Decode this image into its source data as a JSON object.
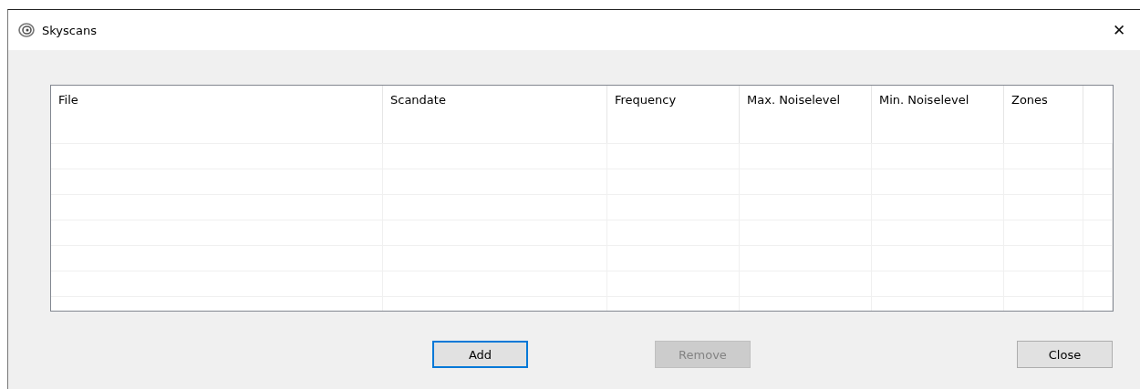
{
  "window": {
    "title": "Skyscans",
    "close": "✕"
  },
  "table": {
    "columns": [
      "File",
      "Scandate",
      "Frequency",
      "Max. Noiselevel",
      "Min. Noiselevel",
      "Zones"
    ]
  },
  "buttons": [
    {
      "label": "Add",
      "focused": true,
      "disabled": false
    },
    {
      "label": "Remove",
      "focused": false,
      "disabled": true
    },
    {
      "label": "Close",
      "focused": false,
      "disabled": false
    }
  ]
}
